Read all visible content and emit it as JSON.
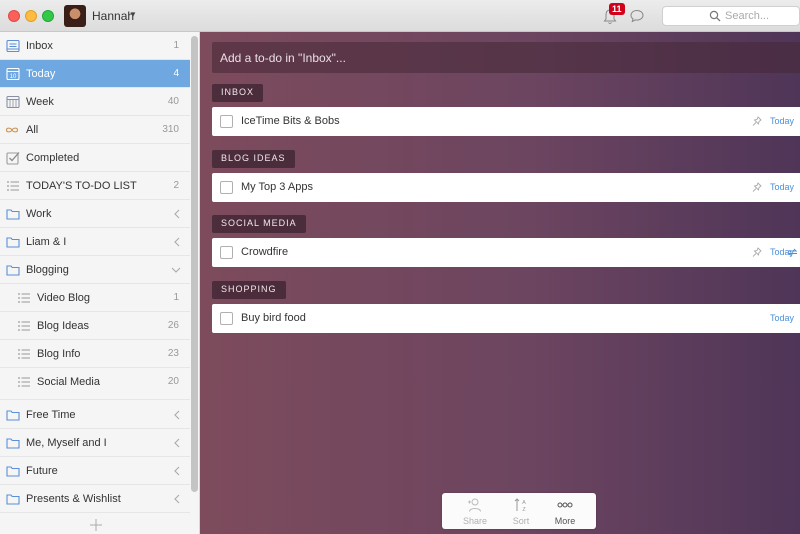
{
  "titlebar": {
    "user_name": "Hannah",
    "notification_count": "11",
    "search_placeholder": "Search..."
  },
  "sidebar": {
    "items": [
      {
        "label": "Inbox",
        "count": "1",
        "icon": "inbox-icon"
      },
      {
        "label": "Today",
        "count": "4",
        "icon": "calendar-icon",
        "selected": true
      },
      {
        "label": "Week",
        "count": "40",
        "icon": "week-icon"
      },
      {
        "label": "All",
        "count": "310",
        "icon": "infinity-icon"
      },
      {
        "label": "Completed",
        "count": "",
        "icon": "check-icon"
      },
      {
        "label": "TODAY'S TO-DO LIST",
        "count": "2",
        "icon": "list-icon"
      },
      {
        "label": "Work",
        "icon": "folder-icon"
      },
      {
        "label": "Liam & I",
        "icon": "folder-icon"
      },
      {
        "label": "Blogging",
        "icon": "folder-icon",
        "expanded": true
      },
      {
        "label": "Video Blog",
        "count": "1",
        "icon": "list-icon"
      },
      {
        "label": "Blog Ideas",
        "count": "26",
        "icon": "list-icon"
      },
      {
        "label": "Blog Info",
        "count": "23",
        "icon": "list-icon"
      },
      {
        "label": "Social Media",
        "count": "20",
        "icon": "list-icon"
      },
      {
        "label": "Free Time",
        "icon": "folder-icon"
      },
      {
        "label": "Me, Myself and I",
        "icon": "folder-icon"
      },
      {
        "label": "Future",
        "icon": "folder-icon"
      },
      {
        "label": "Presents & Wishlist",
        "icon": "folder-icon"
      }
    ]
  },
  "main": {
    "add_placeholder": "Add a to-do in \"Inbox\"...",
    "sections": [
      {
        "title": "INBOX",
        "tasks": [
          {
            "title": "IceTime Bits & Bobs",
            "due": "Today"
          }
        ]
      },
      {
        "title": "BLOG IDEAS",
        "tasks": [
          {
            "title": "My Top 3 Apps",
            "due": "Today"
          }
        ]
      },
      {
        "title": "SOCIAL MEDIA",
        "tasks": [
          {
            "title": "Crowdfire",
            "due": "Today"
          }
        ]
      },
      {
        "title": "SHOPPING",
        "tasks": [
          {
            "title": "Buy bird food",
            "due": "Today"
          }
        ]
      }
    ]
  },
  "toolbar": {
    "share_label": "Share",
    "sort_label": "Sort",
    "more_label": "More"
  },
  "colors": {
    "accent_blue": "#6fa7e0",
    "link_blue": "#4a90d9",
    "badge_red": "#d0021b"
  }
}
